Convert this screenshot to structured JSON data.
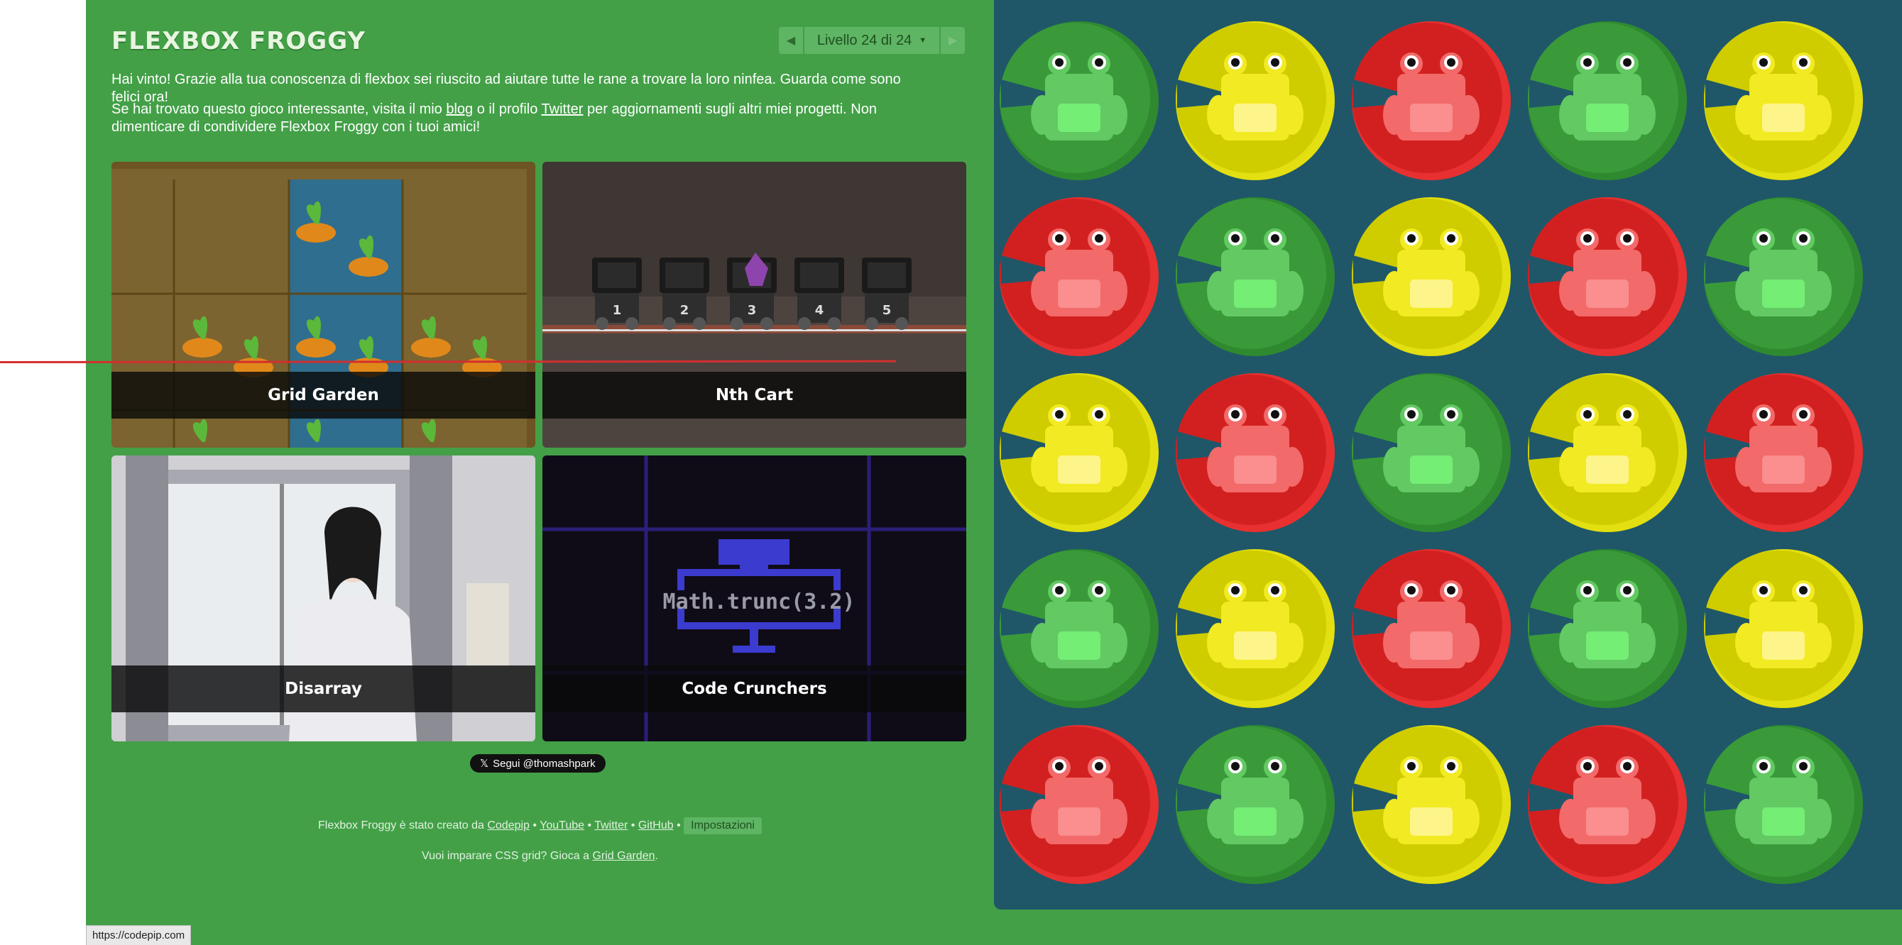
{
  "header": {
    "title": "FLEXBOX FROGGY",
    "level_label": "Livello 24 di 24",
    "prev_icon": "triangle-left-icon",
    "next_icon": "triangle-right-icon"
  },
  "messages": {
    "win": "Hai vinto! Grazie alla tua conoscenza di flexbox sei riuscito ad aiutare tutte le rane a trovare la loro ninfea. Guarda come sono felici ora!",
    "more_1": "Se hai trovato questo gioco interessante, visita il mio ",
    "blog": "blog",
    "more_2": " o il profilo ",
    "twitter": "Twitter",
    "more_3": " per aggiornamenti sugli altri miei progetti. Non dimenticare di condividere Flexbox Froggy con i tuoi amici!"
  },
  "cards": {
    "grid_garden": "Grid Garden",
    "nth_cart": "Nth Cart",
    "disarray": "Disarray",
    "code_crunchers": "Code Crunchers",
    "code_text": "Math.trunc(3.2)",
    "cart_numbers": [
      "1",
      "2",
      "3",
      "4",
      "5"
    ]
  },
  "follow_button": "Segui @thomashpark",
  "credits": {
    "prefix": "Flexbox Froggy è stato creato da ",
    "codepip": "Codepip",
    "youtube": "YouTube",
    "twitter": "Twitter",
    "github": "GitHub",
    "settings": "Impostazioni",
    "sep": " • ",
    "grid_line_prefix": "Vuoi imparare CSS grid? Gioca a ",
    "grid_garden": "Grid Garden",
    "grid_line_suffix": "."
  },
  "status_bar": "https://codepip.com",
  "board": {
    "colors": {
      "green": "#3a9a3a",
      "yellow": "#cfcc00",
      "red": "#d22020",
      "background": "#1f5768"
    },
    "lilypads": [
      [
        "green",
        "yellow",
        "red",
        "green",
        "yellow"
      ],
      [
        "red",
        "green",
        "yellow",
        "red",
        "green"
      ],
      [
        "yellow",
        "red",
        "green",
        "yellow",
        "red"
      ],
      [
        "green",
        "yellow",
        "red",
        "green",
        "yellow"
      ],
      [
        "red",
        "green",
        "yellow",
        "red",
        "green"
      ]
    ],
    "frogs": [
      [
        "green",
        "yellow",
        "red",
        "green",
        "yellow"
      ],
      [
        "red",
        "green",
        "yellow",
        "red",
        "green"
      ],
      [
        "yellow",
        "red",
        "green",
        "yellow",
        "red"
      ],
      [
        "green",
        "yellow",
        "red",
        "green",
        "yellow"
      ],
      [
        "red",
        "green",
        "yellow",
        "red",
        "green"
      ]
    ]
  }
}
